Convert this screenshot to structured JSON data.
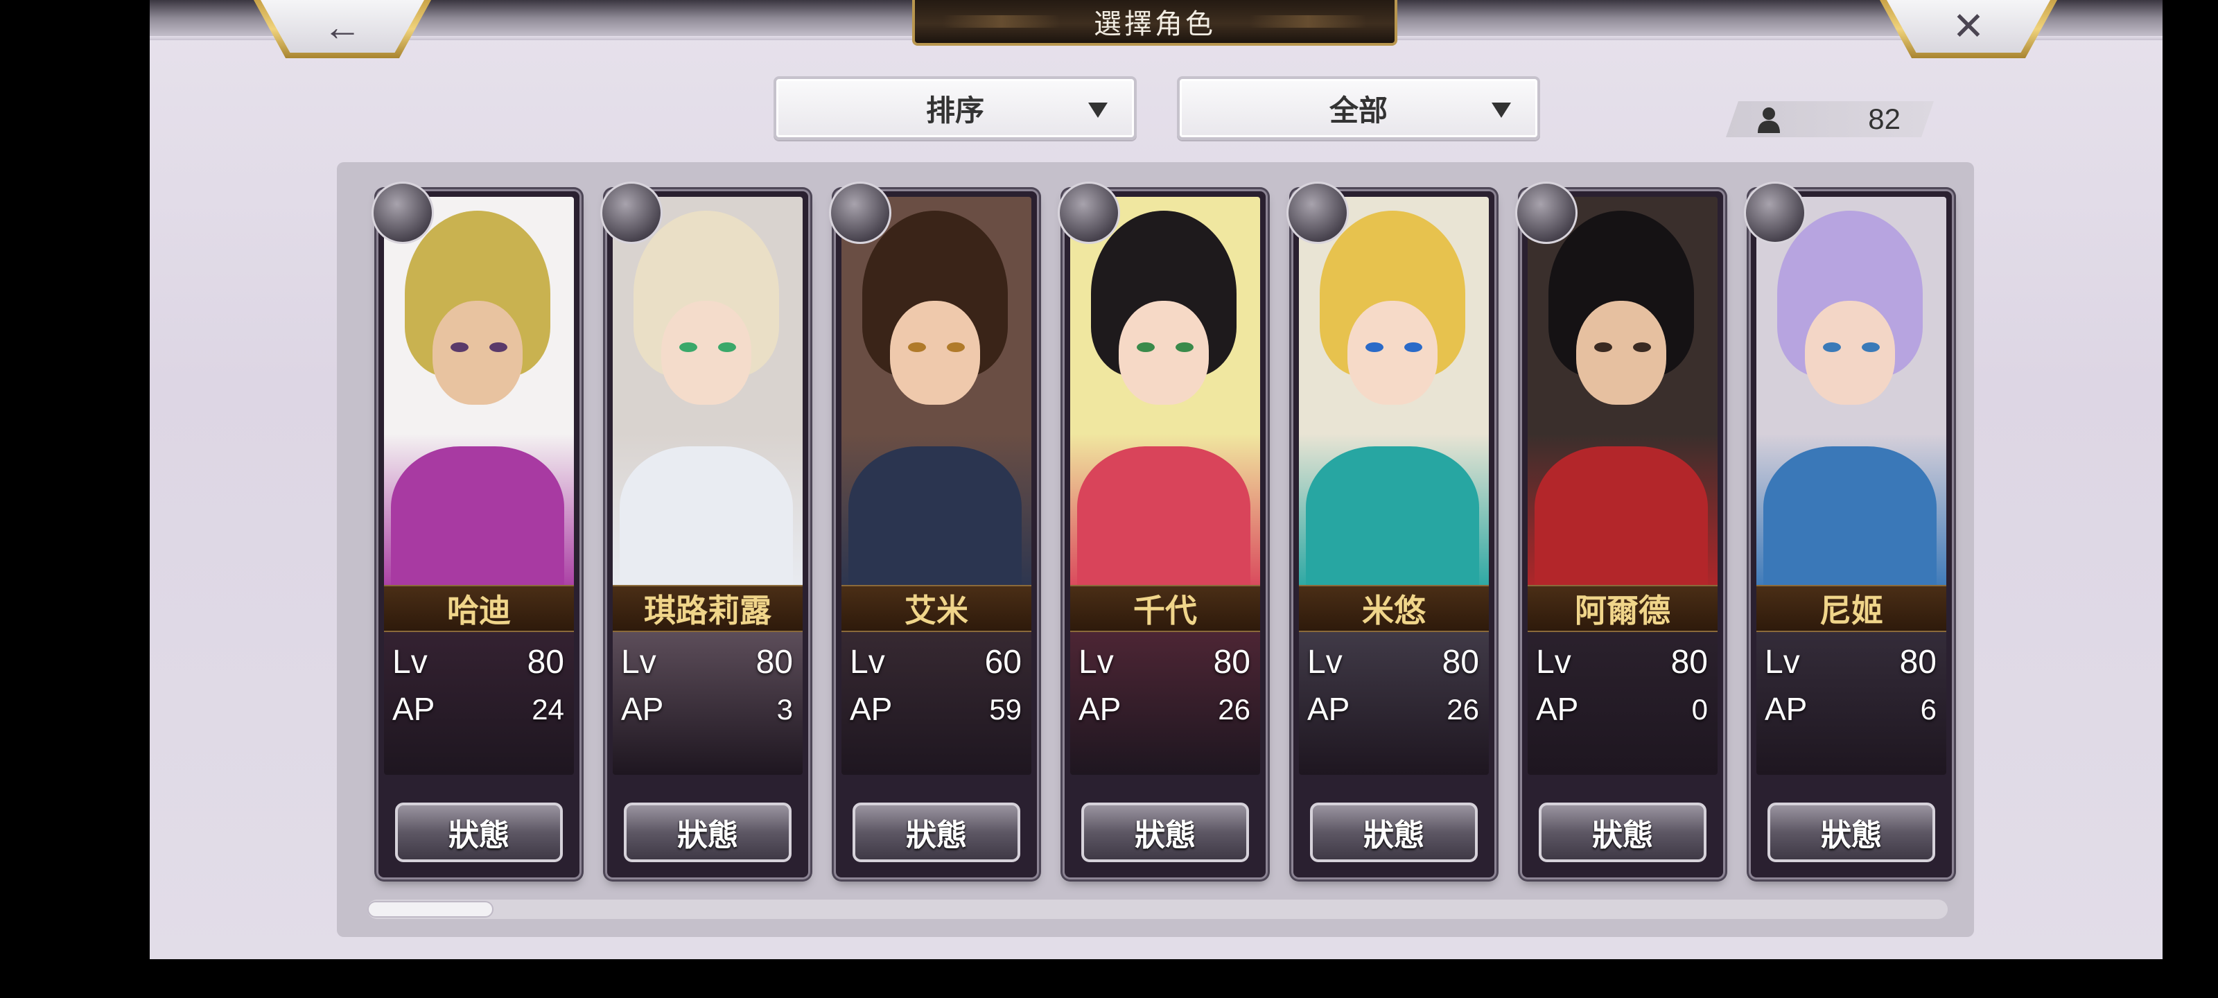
{
  "header": {
    "title": "選擇角色",
    "back_icon": "←",
    "close_icon": "✕"
  },
  "controls": {
    "sort_label": "排序",
    "filter_label": "全部",
    "character_count": "82"
  },
  "scrollbar": {
    "position": 0.0,
    "visible_fraction": 0.08
  },
  "characters": [
    {
      "name": "哈迪",
      "lv_label": "Lv",
      "lv": "80",
      "ap_label": "AP",
      "ap": "24",
      "button": "狀態",
      "class_icon": "gauntlet-icon",
      "colors": {
        "hair": "#c9b250",
        "skin": "#e8c3a0",
        "cloth": "#a83aa2",
        "eye": "#5a3a6a",
        "bg_top": "#f4f2f2",
        "bg_bottom": "#3a2536"
      }
    },
    {
      "name": "琪路莉露",
      "lv_label": "Lv",
      "lv": "80",
      "ap_label": "AP",
      "ap": "3",
      "button": "狀態",
      "class_icon": "sword-icon",
      "colors": {
        "hair": "#eadfc6",
        "skin": "#f4dccb",
        "cloth": "#e9ecf2",
        "eye": "#3aa86a",
        "bg_top": "#d9d3cf",
        "bg_bottom": "#6e5d6a"
      }
    },
    {
      "name": "艾米",
      "lv_label": "Lv",
      "lv": "60",
      "ap_label": "AP",
      "ap": "59",
      "button": "狀態",
      "class_icon": "gauntlet-icon",
      "colors": {
        "hair": "#3a2418",
        "skin": "#efc9ac",
        "cloth": "#2b3550",
        "eye": "#b07a2a",
        "bg_top": "#6a4e44",
        "bg_bottom": "#3d2e36"
      }
    },
    {
      "name": "千代",
      "lv_label": "Lv",
      "lv": "80",
      "ap_label": "AP",
      "ap": "26",
      "button": "狀態",
      "class_icon": "staff-icon",
      "colors": {
        "hair": "#1e1a1c",
        "skin": "#f6d9c6",
        "cloth": "#d9445a",
        "eye": "#3a8a4a",
        "bg_top": "#f0e7a0",
        "bg_bottom": "#5a2a3a"
      }
    },
    {
      "name": "米悠",
      "lv_label": "Lv",
      "lv": "80",
      "ap_label": "AP",
      "ap": "26",
      "button": "狀態",
      "class_icon": "sword-icon",
      "colors": {
        "hair": "#e7c24e",
        "skin": "#f6dac8",
        "cloth": "#27a6a2",
        "eye": "#2a6ac8",
        "bg_top": "#e9e4d4",
        "bg_bottom": "#4a4452"
      }
    },
    {
      "name": "阿爾德",
      "lv_label": "Lv",
      "lv": "80",
      "ap_label": "AP",
      "ap": "0",
      "button": "狀態",
      "class_icon": "sword-icon",
      "colors": {
        "hair": "#151214",
        "skin": "#e6c0a0",
        "cloth": "#b3262a",
        "eye": "#3a2a22",
        "bg_top": "#3a2f2c",
        "bg_bottom": "#2e2430"
      }
    },
    {
      "name": "尼姬",
      "lv_label": "Lv",
      "lv": "80",
      "ap_label": "AP",
      "ap": "6",
      "button": "狀態",
      "class_icon": "scimitar-icon",
      "colors": {
        "hair": "#b7a4e0",
        "skin": "#f3d6c6",
        "cloth": "#3a78b8",
        "eye": "#3a7ab8",
        "bg_top": "#d6d0da",
        "bg_bottom": "#3a3240"
      }
    }
  ]
}
